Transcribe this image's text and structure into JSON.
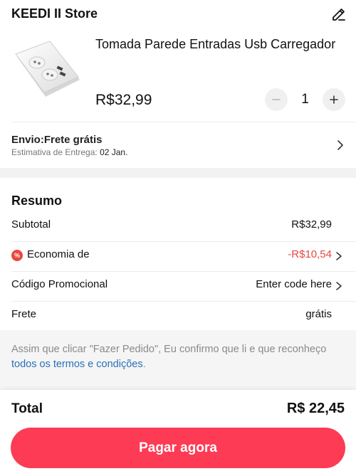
{
  "store": {
    "name": "KEEDI II Store",
    "edit_icon": "pencil-edit-icon"
  },
  "product": {
    "title": "Tomada Parede Entradas Usb Carregador",
    "price": "R$32,99",
    "quantity": "1",
    "minus_icon": "minus-icon",
    "plus_icon": "plus-icon",
    "image_desc": "white-wall-socket-with-usb"
  },
  "shipping": {
    "title": "Envio:Frete grátis",
    "estimate_label": "Estimativa de Entrega:",
    "estimate_date": "02 Jan."
  },
  "summary": {
    "title": "Resumo",
    "subtotal_label": "Subtotal",
    "subtotal_value": "R$32,99",
    "economy_badge": "%",
    "economy_label": "Economia de",
    "economy_value": "-R$10,54",
    "promo_label": "Código Promocional",
    "promo_value": "Enter code here",
    "shipping_label": "Frete",
    "shipping_value": "grátis"
  },
  "notice": {
    "text": "Assim que clicar \"Fazer Pedido\", Eu confirmo que li e que reconheço ",
    "link": "todos os termos e condições",
    "end": "."
  },
  "footer": {
    "total_label": "Total",
    "total_value": "R$ 22,45",
    "pay_button": "Pagar agora"
  },
  "colors": {
    "accent": "#fd3b55",
    "discount": "#e8473f",
    "link": "#2a6fb8"
  }
}
